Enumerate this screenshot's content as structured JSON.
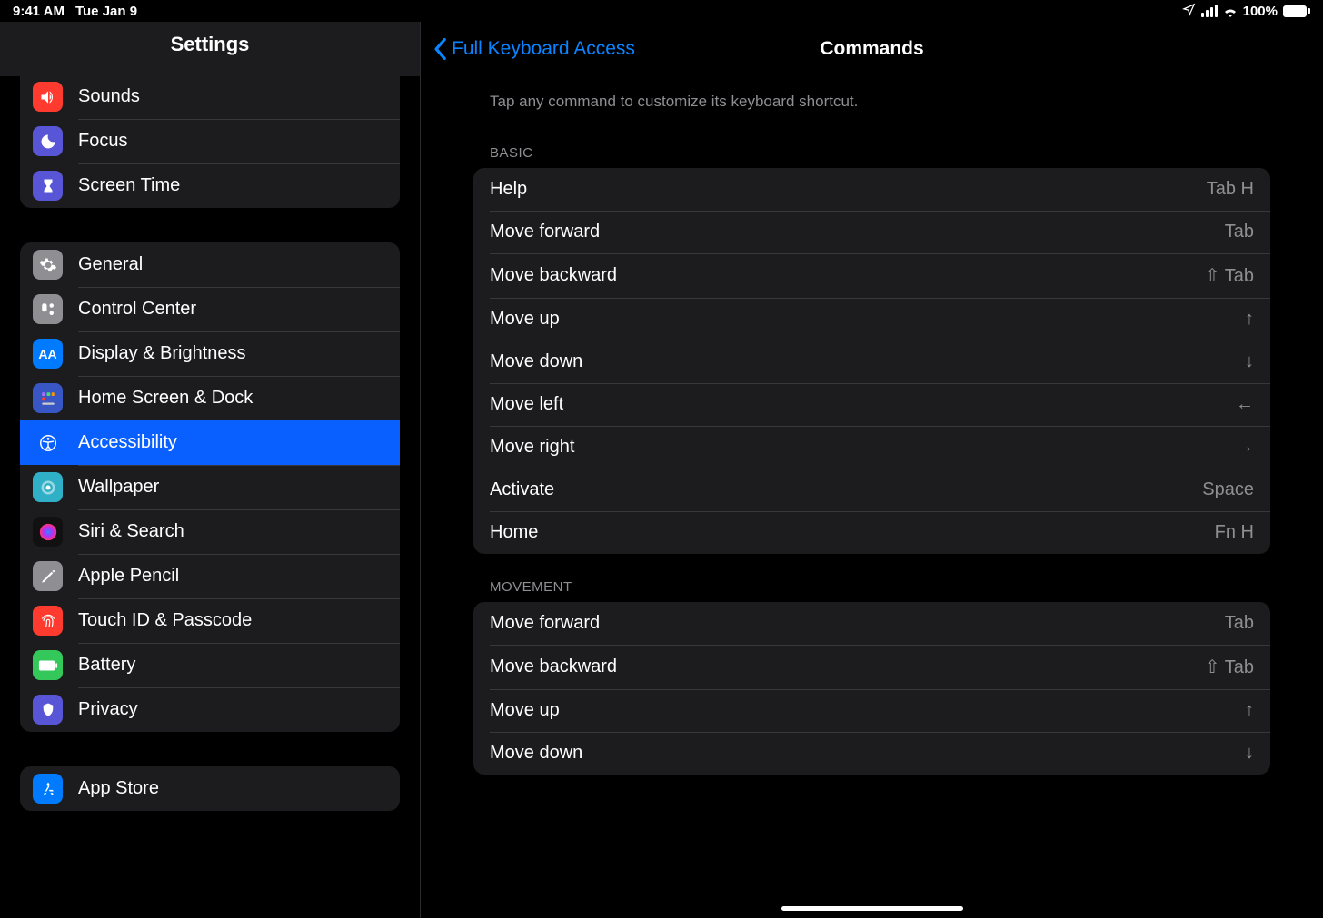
{
  "status": {
    "time": "9:41 AM",
    "date": "Tue Jan 9",
    "battery": "100%"
  },
  "sidebar": {
    "title": "Settings",
    "group1": [
      {
        "label": "Sounds"
      },
      {
        "label": "Focus"
      },
      {
        "label": "Screen Time"
      }
    ],
    "group2": [
      {
        "label": "General"
      },
      {
        "label": "Control Center"
      },
      {
        "label": "Display & Brightness"
      },
      {
        "label": "Home Screen & Dock"
      },
      {
        "label": "Accessibility"
      },
      {
        "label": "Wallpaper"
      },
      {
        "label": "Siri & Search"
      },
      {
        "label": "Apple Pencil"
      },
      {
        "label": "Touch ID & Passcode"
      },
      {
        "label": "Battery"
      },
      {
        "label": "Privacy"
      }
    ],
    "group3": [
      {
        "label": "App Store"
      }
    ]
  },
  "main": {
    "back_label": "Full Keyboard Access",
    "title": "Commands",
    "hint": "Tap any command to customize its keyboard shortcut.",
    "sections": {
      "basic_title": "BASIC",
      "movement_title": "MOVEMENT",
      "basic": [
        {
          "label": "Help",
          "shortcut": "Tab H"
        },
        {
          "label": "Move forward",
          "shortcut": "Tab"
        },
        {
          "label": "Move backward",
          "shortcut": "⇧ Tab"
        },
        {
          "label": "Move up",
          "shortcut": "↑"
        },
        {
          "label": "Move down",
          "shortcut": "↓"
        },
        {
          "label": "Move left",
          "shortcut": "←"
        },
        {
          "label": "Move right",
          "shortcut": "→"
        },
        {
          "label": "Activate",
          "shortcut": "Space"
        },
        {
          "label": "Home",
          "shortcut": "Fn H"
        }
      ],
      "movement": [
        {
          "label": "Move forward",
          "shortcut": "Tab"
        },
        {
          "label": "Move backward",
          "shortcut": "⇧ Tab"
        },
        {
          "label": "Move up",
          "shortcut": "↑"
        },
        {
          "label": "Move down",
          "shortcut": "↓"
        }
      ]
    }
  }
}
